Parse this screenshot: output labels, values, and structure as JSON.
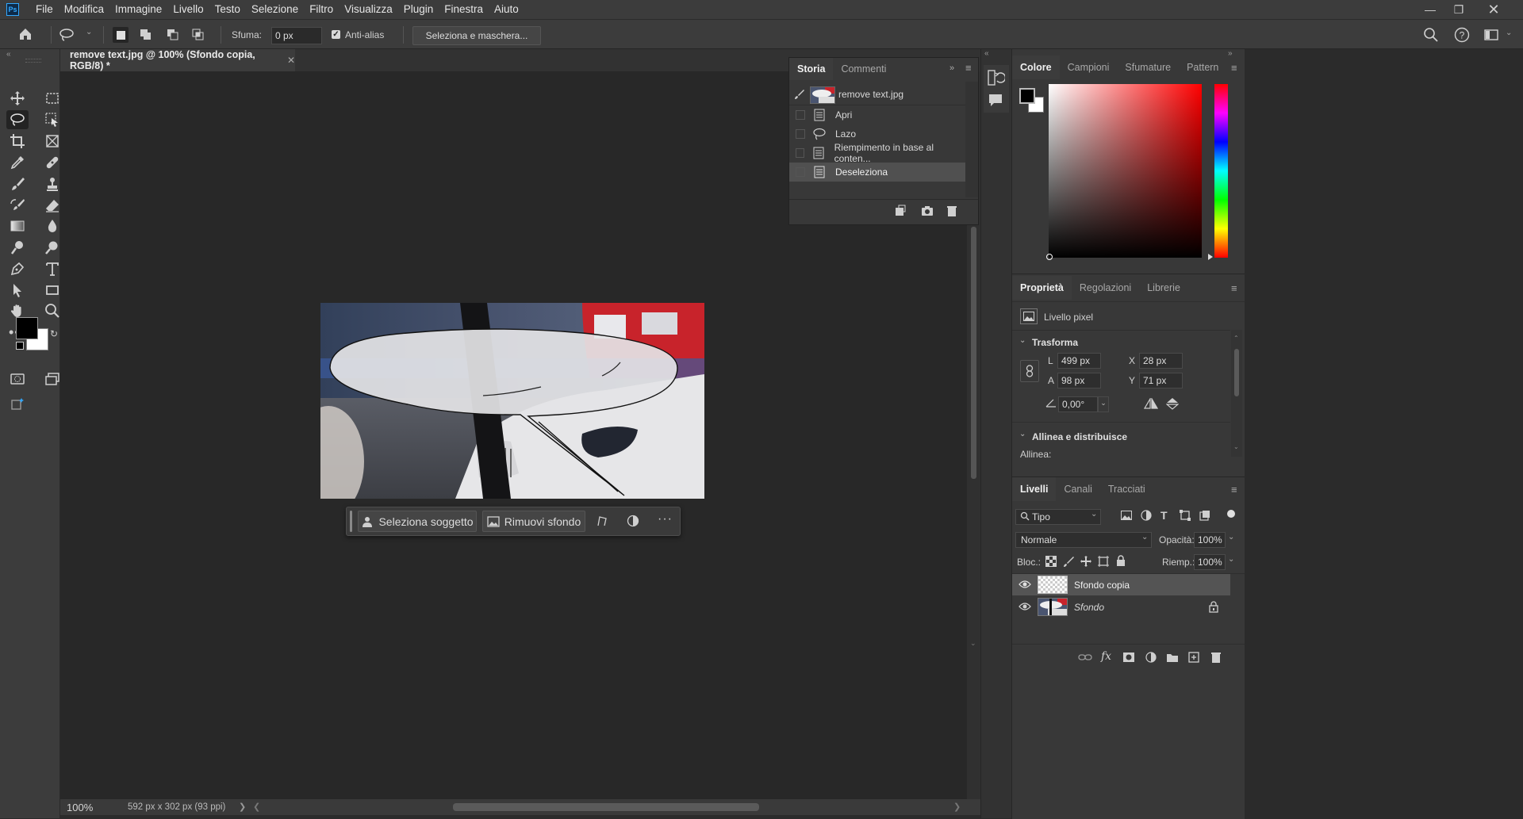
{
  "app": {
    "logo": "Ps",
    "menu": [
      "File",
      "Modifica",
      "Immagine",
      "Livello",
      "Testo",
      "Selezione",
      "Filtro",
      "Visualizza",
      "Plugin",
      "Finestra",
      "Aiuto"
    ],
    "window_controls": [
      "minimize-icon",
      "restore-icon",
      "close-icon"
    ]
  },
  "options_bar": {
    "feather_label": "Sfuma:",
    "feather_value": "0 px",
    "antialias_label": "Anti-alias",
    "antialias_checked": true,
    "select_mask_label": "Seleziona e maschera..."
  },
  "document": {
    "tab_title": "remove text.jpg @ 100% (Sfondo copia, RGB/8) *",
    "zoom": "100%",
    "doc_info": "592 px x 302 px (93 ppi)"
  },
  "contextual_taskbar": {
    "select_subject": "Seleziona soggetto",
    "remove_background": "Rimuovi sfondo"
  },
  "history_panel": {
    "tabs": [
      "Storia",
      "Commenti"
    ],
    "active_tab": "Storia",
    "snapshot": "remove text.jpg",
    "items": [
      {
        "label": "Apri",
        "icon": "document-icon"
      },
      {
        "label": "Lazo",
        "icon": "lasso-icon"
      },
      {
        "label": "Riempimento in base al conten...",
        "icon": "document-icon"
      },
      {
        "label": "Deseleziona",
        "icon": "document-icon",
        "selected": true
      }
    ]
  },
  "color_panel": {
    "tabs": [
      "Colore",
      "Campioni",
      "Sfumature",
      "Pattern"
    ],
    "active_tab": "Colore",
    "foreground": "#000000",
    "background": "#ffffff",
    "hue_color": "#ff0000"
  },
  "properties_panel": {
    "tabs": [
      "Proprietà",
      "Regolazioni",
      "Librerie"
    ],
    "active_tab": "Proprietà",
    "layer_type": "Livello pixel",
    "transform_title": "Trasforma",
    "w_label": "L",
    "w_value": "499 px",
    "h_label": "A",
    "h_value": "98 px",
    "x_label": "X",
    "x_value": "28 px",
    "y_label": "Y",
    "y_value": "71 px",
    "angle_value": "0,00°",
    "align_title": "Allinea e distribuisce",
    "align_label": "Allinea:"
  },
  "layers_panel": {
    "tabs": [
      "Livelli",
      "Canali",
      "Tracciati"
    ],
    "active_tab": "Livelli",
    "filter_kind": "Tipo",
    "blend_mode": "Normale",
    "opacity_label": "Opacità:",
    "opacity_value": "100%",
    "lock_label": "Bloc.:",
    "fill_label": "Riemp.:",
    "fill_value": "100%",
    "layers": [
      {
        "name": "Sfondo copia",
        "visible": true,
        "selected": true,
        "locked": false
      },
      {
        "name": "Sfondo",
        "visible": true,
        "selected": false,
        "locked": true
      }
    ]
  }
}
